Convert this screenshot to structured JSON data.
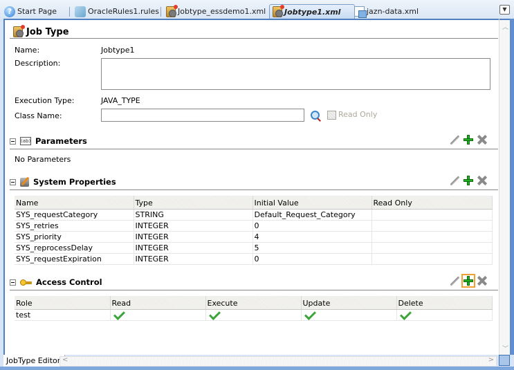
{
  "tabs": [
    {
      "label": "Start Page",
      "icon": "help-icon",
      "active": false
    },
    {
      "label": "OracleRules1.rules",
      "icon": "rules-icon",
      "active": false
    },
    {
      "label": "Jobtype_essdemo1.xml",
      "icon": "jobtype-icon",
      "active": false
    },
    {
      "label": "Jobtype1.xml",
      "icon": "jobtype-icon",
      "active": true
    },
    {
      "label": "jazn-data.xml",
      "icon": "xml-file-icon",
      "active": false
    }
  ],
  "editor": {
    "title": "Job Type",
    "name_label": "Name:",
    "name_value": "Jobtype1",
    "description_label": "Description:",
    "description_value": "",
    "execution_type_label": "Execution Type:",
    "execution_type_value": "JAVA_TYPE",
    "class_name_label": "Class Name:",
    "class_name_value": "",
    "read_only_label": "Read Only",
    "read_only_checked": false
  },
  "parameters": {
    "title": "Parameters",
    "empty_text": "No Parameters"
  },
  "system_properties": {
    "title": "System Properties",
    "columns": [
      "Name",
      "Type",
      "Initial Value",
      "Read Only"
    ],
    "rows": [
      [
        "SYS_requestCategory",
        "STRING",
        "Default_Request_Category",
        ""
      ],
      [
        "SYS_retries",
        "INTEGER",
        "0",
        ""
      ],
      [
        "SYS_priority",
        "INTEGER",
        "4",
        ""
      ],
      [
        "SYS_reprocessDelay",
        "INTEGER",
        "5",
        ""
      ],
      [
        "SYS_requestExpiration",
        "INTEGER",
        "0",
        ""
      ]
    ]
  },
  "access_control": {
    "title": "Access Control",
    "columns": [
      "Role",
      "Read",
      "Execute",
      "Update",
      "Delete"
    ],
    "rows": [
      {
        "role": "test",
        "read": true,
        "execute": true,
        "update": true,
        "delete": true
      }
    ]
  },
  "bottom_tab": "JobType Editor",
  "colors": {
    "accent": "#4f7fbf",
    "add_green": "#21b21f",
    "check_green": "#3ba53b"
  }
}
